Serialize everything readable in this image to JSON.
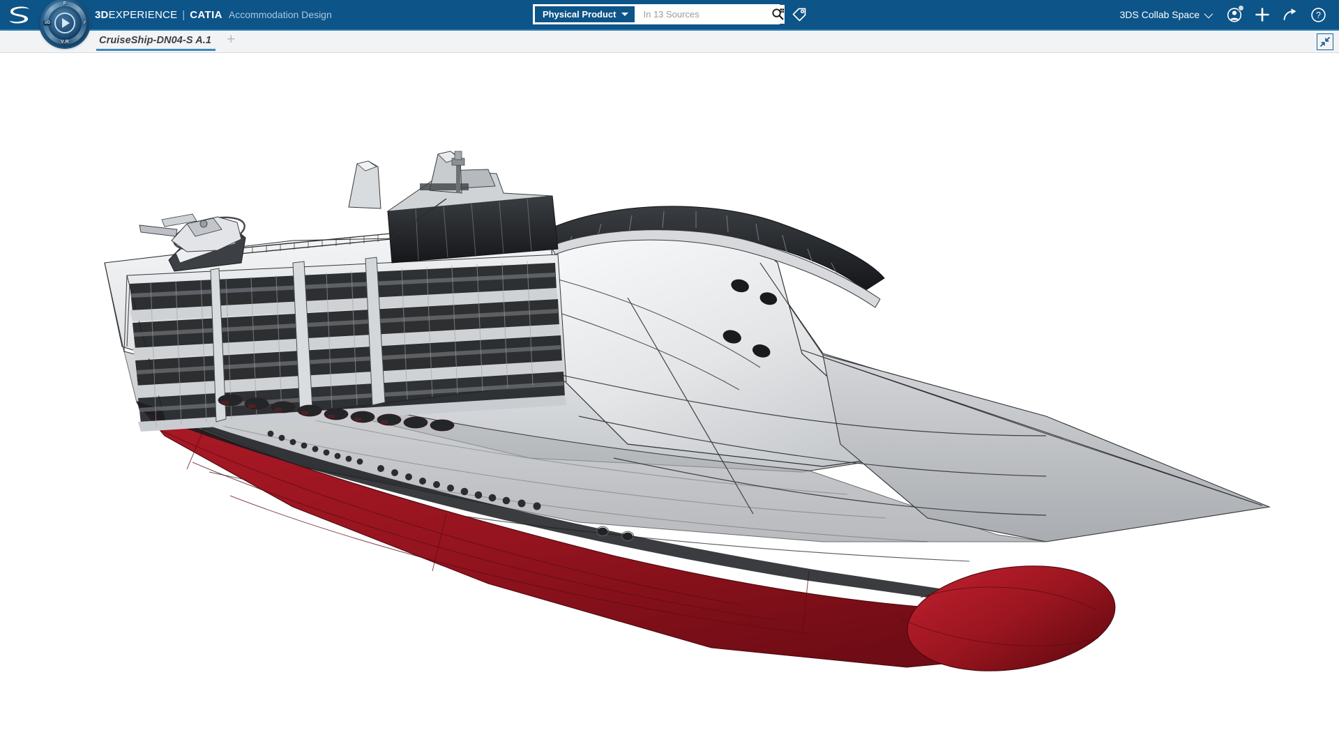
{
  "header": {
    "logo_icon": "3ds-logo-icon",
    "compass": {
      "icon": "3d-compass-navigation-widget",
      "label_top": "F",
      "label_left": "3D",
      "label_right": "r",
      "label_bottom": "V.R",
      "center_icon": "play-triangle-icon"
    },
    "brand_prefix_bold": "3D",
    "brand_prefix_light": "EXPERIENCE",
    "brand_separator": "|",
    "brand_product": "CATIA",
    "brand_app": "Accommodation Design"
  },
  "search": {
    "scope_label": "Physical Product",
    "scope_caret_icon": "chevron-down-icon",
    "placeholder": "In 13 Sources",
    "value": "",
    "search_icon": "search-magnifier-icon",
    "tag_icon": "tag-label-icon"
  },
  "header_right": {
    "collab_space_label": "3DS Collab Space",
    "collab_caret_icon": "chevron-down-icon",
    "icons": [
      {
        "name": "user-account-icon",
        "badge": true
      },
      {
        "name": "plus-add-icon",
        "badge": false
      },
      {
        "name": "share-arrow-icon",
        "badge": false
      },
      {
        "name": "help-question-icon",
        "badge": false
      }
    ]
  },
  "tabs": {
    "items": [
      {
        "label": "CruiseShip-DN04-S A.1",
        "active": true
      }
    ],
    "add_label": "+",
    "add_icon": "plus-new-tab-icon",
    "collapse_icon": "collapse-inward-arrows-icon"
  },
  "viewport": {
    "model_name": "CruiseShip-DN04-S A.1",
    "background_color": "#ffffff",
    "render_mode": "shaded-with-edges",
    "colors": {
      "hull_light": "#e9eaec",
      "hull_mid": "#c9cbce",
      "hull_shadow": "#a7aaae",
      "deck_dark": "#4a4d51",
      "window_dark": "#1c1d1f",
      "antifouling_red": "#9b1722",
      "antifouling_red_dark": "#7d101a",
      "edge_line": "#2c2e31"
    },
    "accent_blue": "#0d5488",
    "tabbar_bg": "#f2f3f5",
    "tab_underline": "#3e87bd"
  }
}
